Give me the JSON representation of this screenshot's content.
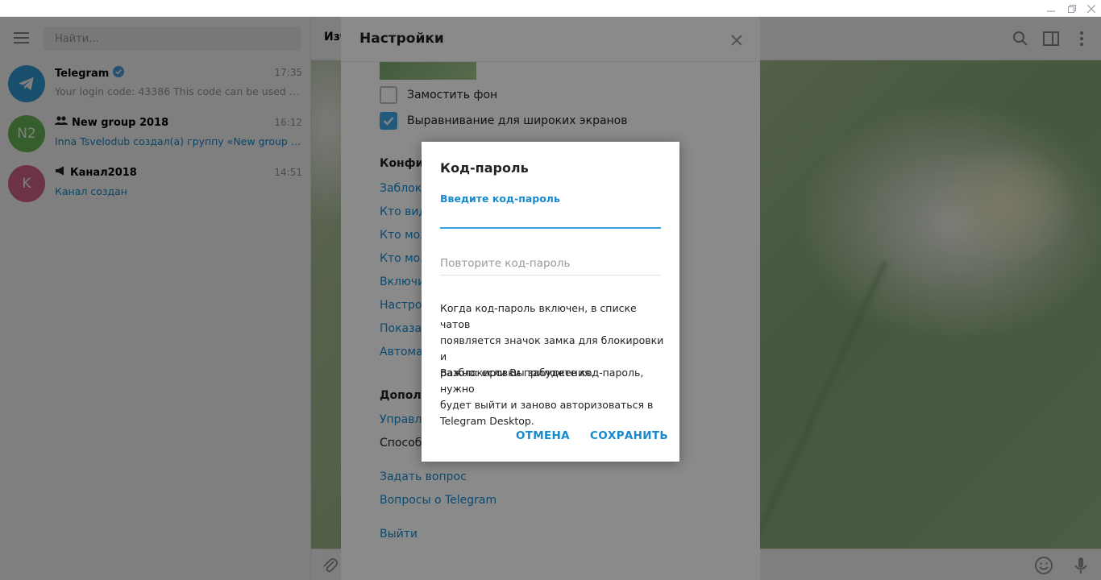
{
  "sidebar": {
    "search_placeholder": "Найти...",
    "chats": [
      {
        "name": "Telegram",
        "time": "17:35",
        "preview": "Your login code: 43386  This code can be used to l...",
        "avatar_text": "",
        "avatar_color": "#2f9fd8"
      },
      {
        "name": "New group 2018",
        "time": "16:12",
        "preview": "Inna Tsvelodub создал(а) группу «New group 201...",
        "avatar_text": "N2",
        "avatar_color": "#6dbb58"
      },
      {
        "name": "Канал2018",
        "time": "14:51",
        "preview": "Канал создан",
        "avatar_text": "K",
        "avatar_color": "#d8648a"
      }
    ]
  },
  "header": {
    "title": "Изб"
  },
  "settings": {
    "title": "Настройки",
    "checkbox_tile": "Замостить фон",
    "checkbox_wide": "Выравнивание для широких экранов",
    "section_privacy": "Конфи",
    "privacy_items": [
      "Заблок",
      "Кто вид",
      "Кто мож",
      "Кто мож",
      "Включи",
      "Настро",
      "Показа",
      "Автома"
    ],
    "section_advanced": "Допол",
    "advanced_link": "Управл",
    "advanced_plain": "Способ",
    "ask_question": "Задать вопрос",
    "faq": "Вопросы о Telegram",
    "logout": "Выйти"
  },
  "modal": {
    "title": "Код-пароль",
    "enter_label": "Введите код-пароль",
    "enter_value": "",
    "repeat_placeholder": "Повторите код-пароль",
    "text1_lines": [
      "Когда код-пароль включен, в списке чатов",
      "появляется значок замка для блокировки и",
      "разблокировки приложения."
    ],
    "text2_lines": [
      "Важно: если Вы забудете код-пароль, нужно",
      "будет выйти и заново авторизоваться в",
      "Telegram Desktop."
    ],
    "cancel": "ОТМЕНА",
    "save": "СОХРАНИТЬ"
  },
  "colors": {
    "accent": "#168acd",
    "field_underline": "#37a1de",
    "checkbox_on": "#40a7e3"
  }
}
